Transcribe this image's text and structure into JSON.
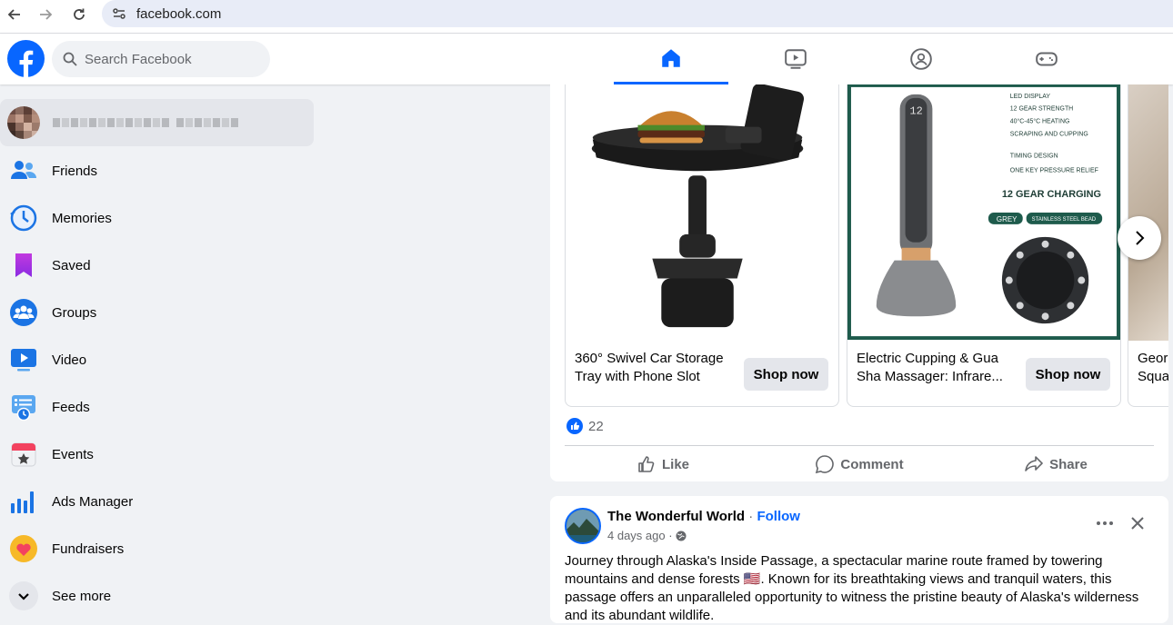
{
  "browser": {
    "url": "facebook.com"
  },
  "header": {
    "search_placeholder": "Search Facebook"
  },
  "sidebar": {
    "items": [
      {
        "label": "Friends",
        "icon": "friends-icon"
      },
      {
        "label": "Memories",
        "icon": "memories-icon"
      },
      {
        "label": "Saved",
        "icon": "saved-icon"
      },
      {
        "label": "Groups",
        "icon": "groups-icon"
      },
      {
        "label": "Video",
        "icon": "video-icon"
      },
      {
        "label": "Feeds",
        "icon": "feeds-icon"
      },
      {
        "label": "Events",
        "icon": "events-icon"
      },
      {
        "label": "Ads Manager",
        "icon": "ads-manager-icon"
      },
      {
        "label": "Fundraisers",
        "icon": "fundraisers-icon"
      },
      {
        "label": "See more",
        "icon": "chevron-down-icon"
      }
    ]
  },
  "ad_post": {
    "products": [
      {
        "title": "360° Swivel Car Storage Tray with Phone Slot",
        "cta": "Shop now"
      },
      {
        "title": "Electric Cupping & Gua Sha Massager: Infrare...",
        "cta": "Shop now",
        "image_text": {
          "features": [
            "LED DISPLAY",
            "12 GEAR STRENGTH",
            "40°C-45°C HEATING",
            "SCRAPING AND CUPPING",
            "TIMING DESIGN",
            "ONE KEY PRESSURE RELIEF"
          ],
          "headline": "12 GEAR CHARGING",
          "badges": [
            "GREY",
            "STAINLESS STEEL BEAD"
          ],
          "display": "12"
        }
      },
      {
        "title": "Geor Squa"
      }
    ],
    "reaction_count": "22",
    "actions": {
      "like": "Like",
      "comment": "Comment",
      "share": "Share"
    }
  },
  "post2": {
    "author": "The Wonderful World",
    "separator": "·",
    "follow": "Follow",
    "time": "4 days ago ·",
    "text": "Journey through Alaska's Inside Passage, a spectacular marine route framed by towering mountains and dense forests 🇺🇸. Known for its breathtaking views and tranquil waters, this passage offers an unparalleled opportunity to witness the pristine beauty of Alaska's wilderness and its abundant wildlife."
  },
  "colors": {
    "brand": "#0866ff",
    "page_bg": "#f0f2f5",
    "secondary_text": "#65676b"
  }
}
